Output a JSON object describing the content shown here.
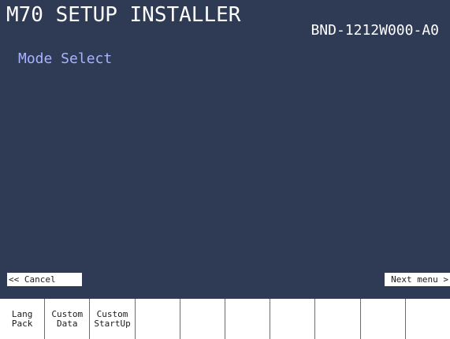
{
  "header": {
    "title": "M70 SETUP INSTALLER",
    "version": "BND-1212W000-A0"
  },
  "main": {
    "mode_title": "Mode Select"
  },
  "nav": {
    "cancel_label": "<< Cancel",
    "next_label": "Next menu >"
  },
  "softkeys": [
    {
      "line1": "Lang",
      "line2": "Pack"
    },
    {
      "line1": "Custom",
      "line2": "Data"
    },
    {
      "line1": "Custom",
      "line2": "StartUp"
    },
    {
      "line1": "",
      "line2": ""
    },
    {
      "line1": "",
      "line2": ""
    },
    {
      "line1": "",
      "line2": ""
    },
    {
      "line1": "",
      "line2": ""
    },
    {
      "line1": "",
      "line2": ""
    },
    {
      "line1": "",
      "line2": ""
    },
    {
      "line1": "",
      "line2": ""
    }
  ],
  "colors": {
    "background": "#2f3a55",
    "accent_text": "#a9b3ff",
    "softkey_bar": "#ffffff"
  }
}
